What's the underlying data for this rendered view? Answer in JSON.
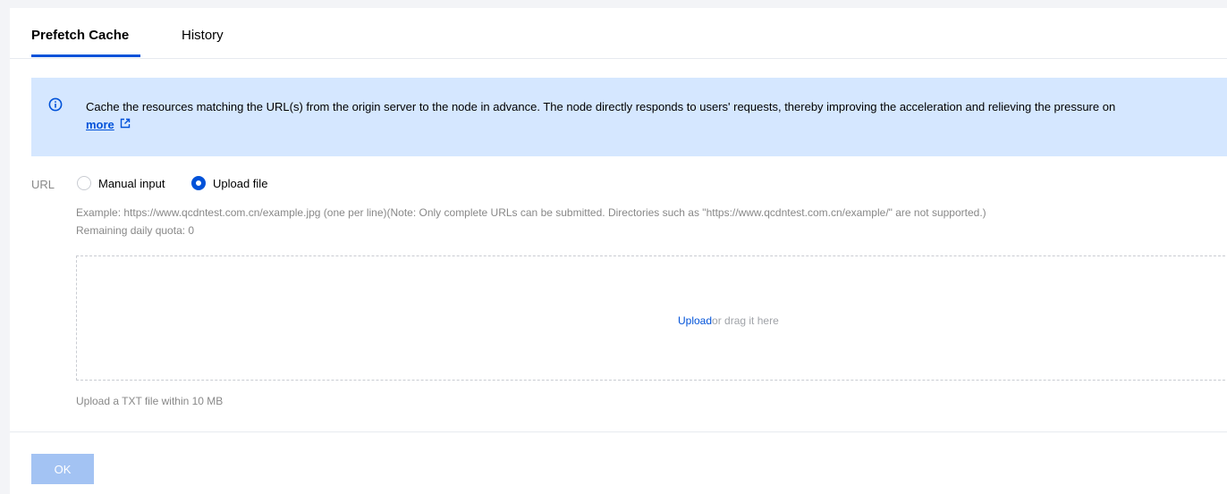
{
  "tabs": [
    {
      "label": "Prefetch Cache",
      "active": true
    },
    {
      "label": "History",
      "active": false
    }
  ],
  "alert": {
    "icon": "info-icon",
    "text": "Cache the resources matching the URL(s) from the origin server to the node in advance. The node directly responds to users' requests, thereby improving the acceleration and relieving the pressure on",
    "more_label": "more",
    "more_icon": "external-link-icon"
  },
  "form": {
    "url_label": "URL",
    "radio_options": [
      {
        "label": "Manual input",
        "checked": false
      },
      {
        "label": "Upload file",
        "checked": true
      }
    ],
    "example_hint": "Example: https://www.qcdntest.com.cn/example.jpg (one per line)(Note: Only complete URLs can be submitted. Directories such as \"https://www.qcdntest.com.cn/example/\" are not supported.)",
    "quota_hint": "Remaining daily quota: 0",
    "dropzone": {
      "upload_label": "Upload",
      "drag_label": "or drag it here"
    },
    "file_limit_hint": "Upload a TXT file within 10 MB"
  },
  "footer": {
    "ok_label": "OK"
  },
  "colors": {
    "accent": "#0052d9",
    "alert_bg": "#d5e7ff",
    "ok_disabled_bg": "#a3c3f3"
  }
}
